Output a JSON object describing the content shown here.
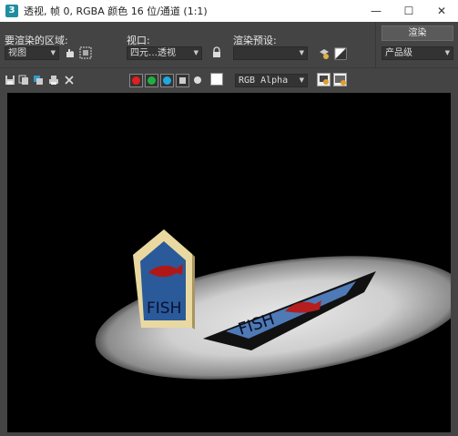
{
  "window": {
    "app_icon": "3",
    "title": "透视, 帧 0, RGBA 颜色 16 位/通道 (1:1)",
    "minimize": "—",
    "maximize": "☐",
    "close": "✕"
  },
  "panel": {
    "area_label": "要渲染的区域:",
    "area_value": "视图",
    "viewport_label": "视口:",
    "viewport_value": "四元…透视",
    "preset_label": "渲染预设:",
    "preset_value": "",
    "render_button": "渲染",
    "quality_value": "产品级"
  },
  "toolbar": {
    "channel_value": "RGB Alpha"
  },
  "scene": {
    "sign_text": "FISH",
    "shadow_text": "FISH"
  },
  "colors": {
    "channel_red": "#e02020",
    "channel_green": "#20b040",
    "channel_blue": "#20a8e0"
  }
}
